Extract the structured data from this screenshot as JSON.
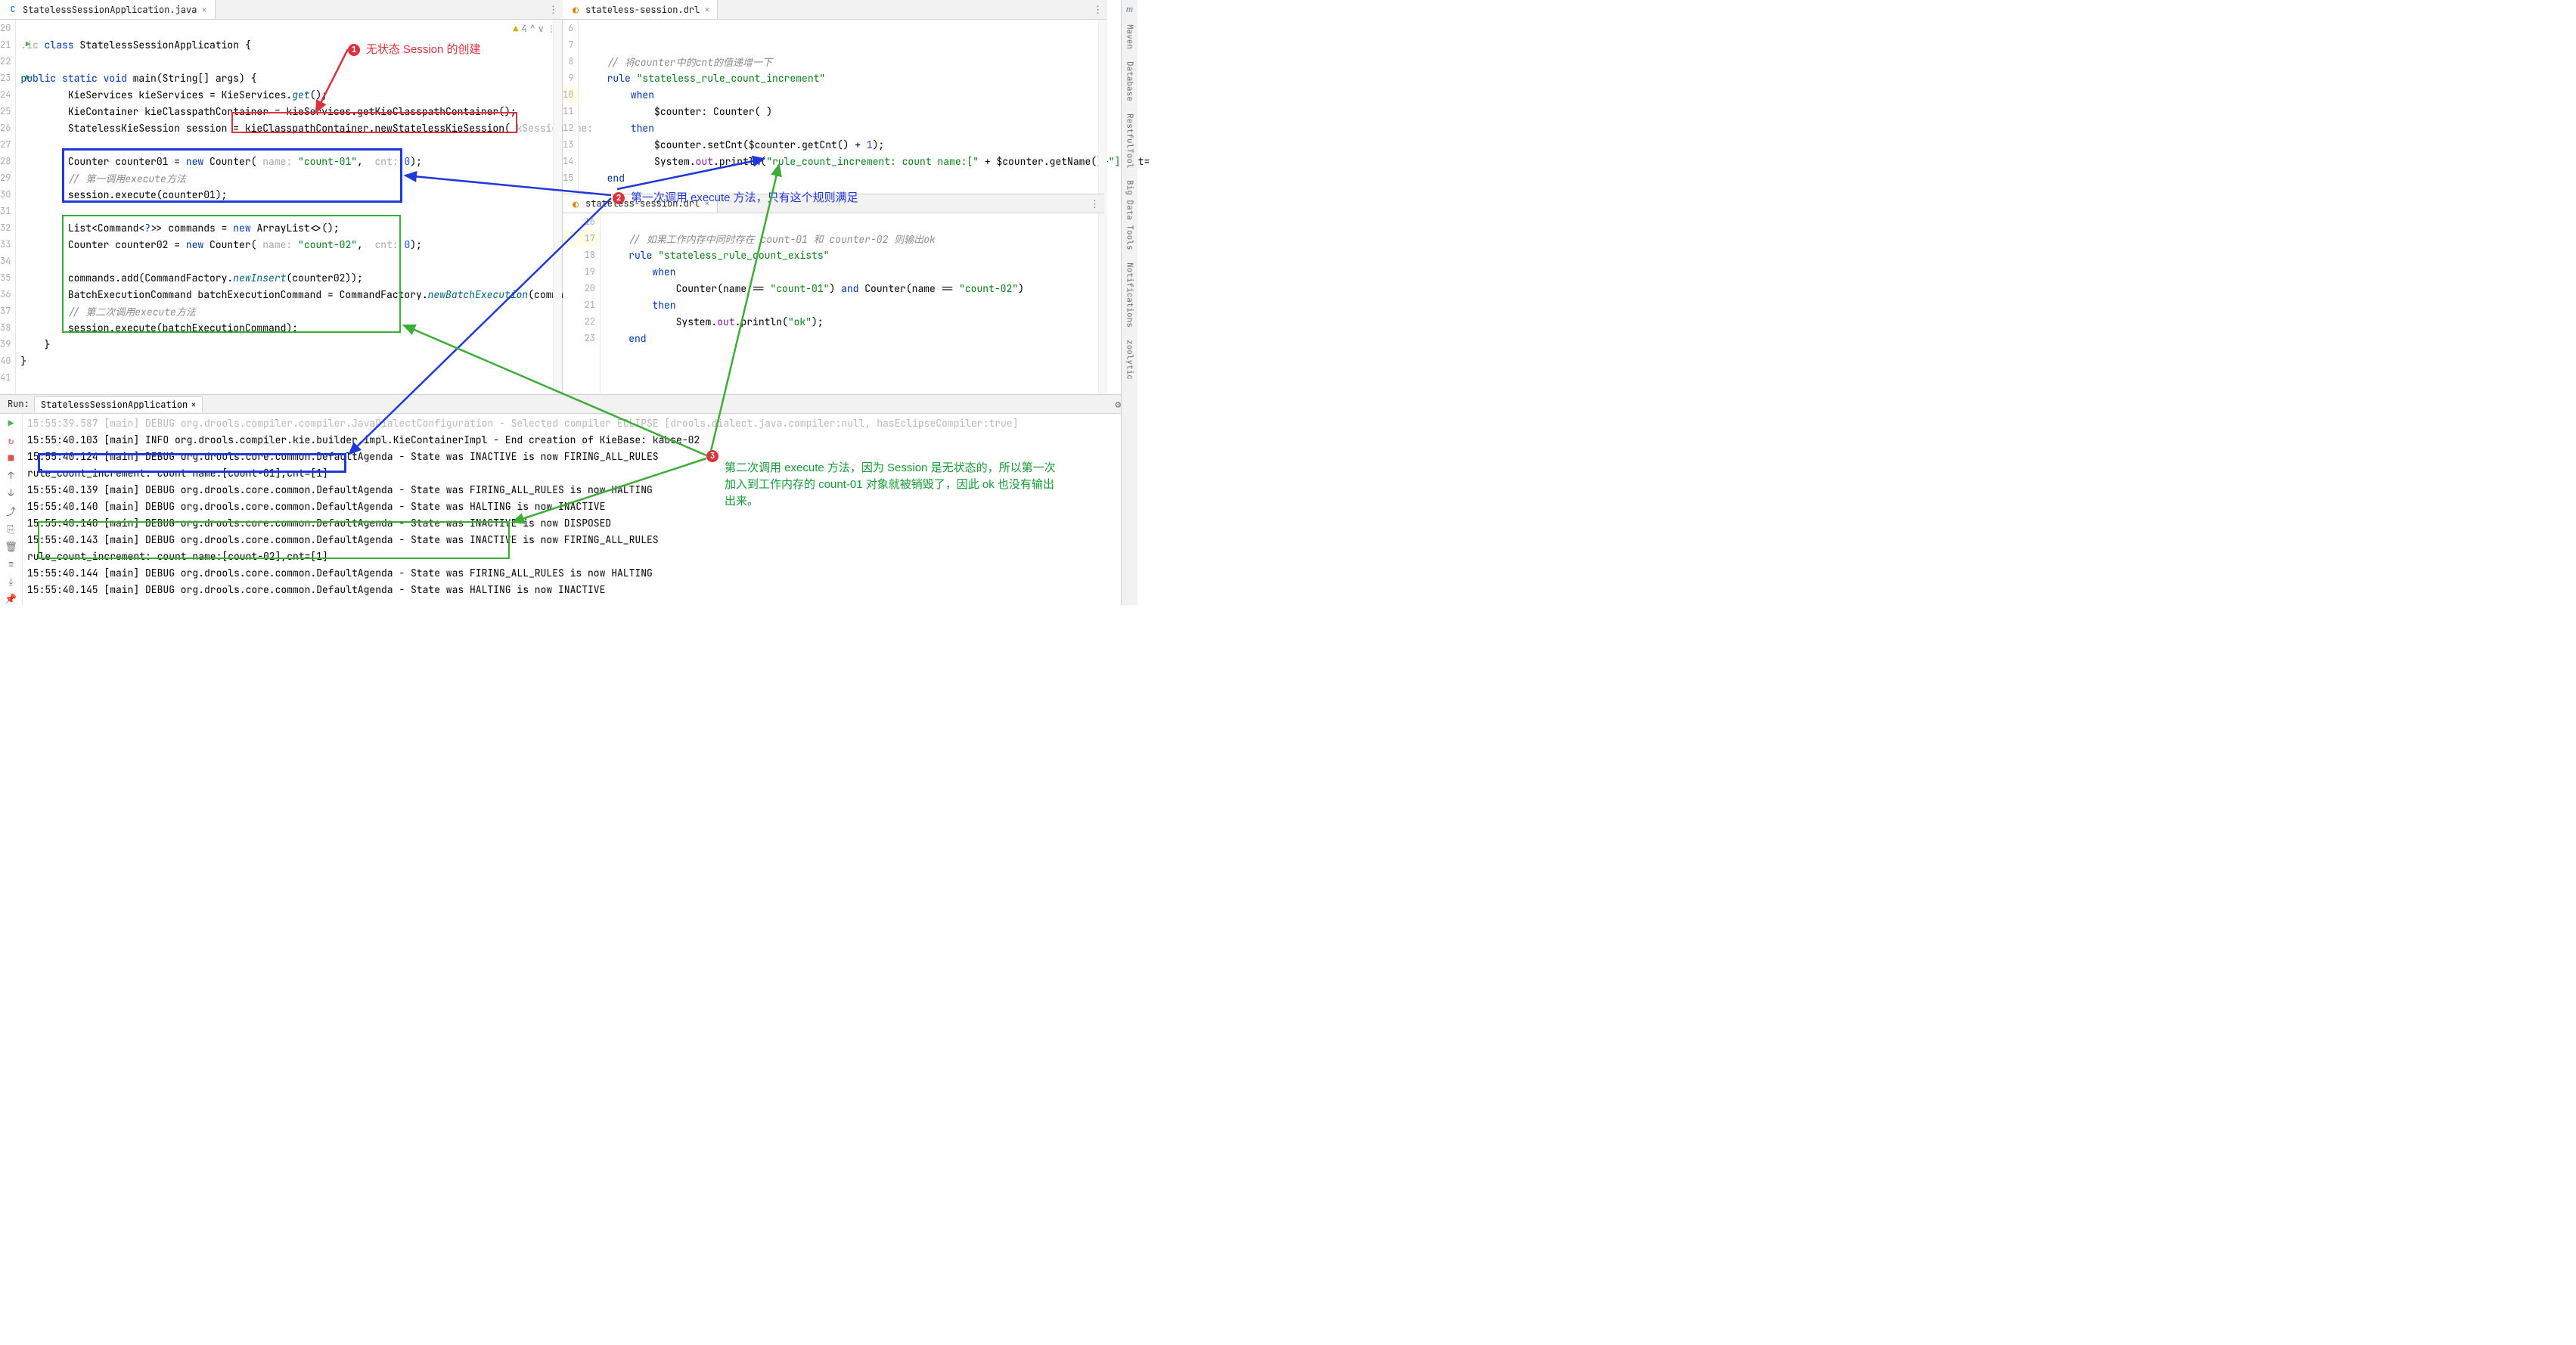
{
  "tabs": {
    "left": {
      "icon": "java",
      "name": "StatelessSessionApplication.java"
    },
    "right_top": {
      "icon": "drl",
      "name": "stateless-session.drl"
    },
    "right_bottom": {
      "icon": "drl",
      "name": "stateless-session.drl"
    }
  },
  "inspection": {
    "warn_count": "4"
  },
  "left_gutter": [
    "20",
    "21",
    "22",
    "23",
    "24",
    "25",
    "26",
    "27",
    "28",
    "29",
    "30",
    "31",
    "32",
    "33",
    "34",
    "35",
    "36",
    "37",
    "38",
    "39",
    "40",
    "41"
  ],
  "left_run_rows": [
    "21",
    "23"
  ],
  "left_lines": {
    "20": "",
    "21": {
      "pre": ".ic ",
      "kw": "class",
      "rest": " StatelessSessionApplication {"
    },
    "22": "",
    "23": {
      "kw1": "public static ",
      "kw2": "void",
      "name": " main",
      "rest": "(String[] args) {"
    },
    "24": {
      "indent": "        ",
      "t": "KieServices kieServices = KieServices.",
      "mth": "get",
      "t2": "();"
    },
    "25": {
      "indent": "        ",
      "t": "KieContainer kieClasspathContainer = kieServices.getKieClasspathContainer();"
    },
    "26": {
      "indent": "        ",
      "t": "StatelessKieSession session = kieClasspathContainer.newStatelessKieSession(",
      "hint": " kSessionName:"
    },
    "27": "",
    "28": {
      "indent": "        ",
      "t": "Counter counter01 = ",
      "kw": "new",
      "t2": " Counter(",
      "h1": " name: ",
      "s1": "\"count-01\"",
      "c": ",",
      "h2": "  cnt: ",
      "n": "0",
      "t3": ");"
    },
    "29": {
      "indent": "        ",
      "cmt": "// 第一调用execute方法"
    },
    "30": {
      "indent": "        ",
      "t": "session.execute(counter01);"
    },
    "31": "",
    "32": {
      "indent": "        ",
      "t": "List<Command<",
      "kw": "?",
      "t2": ">> commands = ",
      "kw2": "new",
      "t3": " ArrayList<>();"
    },
    "33": {
      "indent": "        ",
      "t": "Counter counter02 = ",
      "kw": "new",
      "t2": " Counter(",
      "h1": " name: ",
      "s1": "\"count-02\"",
      "c": ",",
      "h2": "  cnt: ",
      "n": "0",
      "t3": ");"
    },
    "34": "",
    "35": {
      "indent": "        ",
      "t": "commands.add(CommandFactory.",
      "mth": "newInsert",
      "t2": "(counter02));"
    },
    "36": {
      "indent": "        ",
      "t": "BatchExecutionCommand batchExecutionCommand = CommandFactory.",
      "mth": "newBatchExecution",
      "t2": "(commands)"
    },
    "37": {
      "indent": "        ",
      "cmt": "// 第二次调用execute方法"
    },
    "38": {
      "indent": "        ",
      "t": "session.execute(batchExecutionCommand);"
    },
    "39": "    }",
    "40": "}",
    "41": ""
  },
  "right_top_gutter": [
    "6",
    "7",
    "8",
    "9",
    "10",
    "11",
    "12",
    "13",
    "14",
    "15"
  ],
  "right_top_lines": {
    "6": "",
    "7": "",
    "8": {
      "cmt": "// 将counter中的cnt的值递增一下"
    },
    "9": {
      "kw": "rule ",
      "s": "\"stateless_rule_count_increment\""
    },
    "10": {
      "kw": "when"
    },
    "11": {
      "t": "$counter: Counter( )"
    },
    "12": {
      "kw": "then"
    },
    "13": {
      "t": "$counter.setCnt($counter.getCnt() + ",
      "n": "1",
      "t2": ");"
    },
    "14": {
      "t": "System.",
      "f": "out",
      "t2": ".println(",
      "s": "\"rule_count_increment: count name:[\"",
      "t3": " + $counter.getName()+",
      "s2": "\"]",
      "t4": ",cnt="
    },
    "15": {
      "kw": "end"
    }
  },
  "right_bot_gutter": [
    "16",
    "17",
    "18",
    "19",
    "20",
    "21",
    "22",
    "23"
  ],
  "right_bot_lines": {
    "16": "",
    "17": {
      "cmt": "// 如果工作内存中同时存在 count-01 和 counter-02 则输出ok"
    },
    "18": {
      "kw": "rule ",
      "s": "\"stateless_rule_count_exists\""
    },
    "19": {
      "kw": "when"
    },
    "20": {
      "t": "Counter(name == ",
      "s": "\"count-01\"",
      "t2": ") ",
      "kw": "and",
      "t3": " Counter(name == ",
      "s2": "\"count-02\"",
      "t4": ")"
    },
    "21": {
      "kw": "then"
    },
    "22": {
      "t": "System.",
      "f": "out",
      "t2": ".println(",
      "s": "\"ok\"",
      "t3": ");"
    },
    "23": {
      "kw": "end"
    }
  },
  "annotations": {
    "a1": "无状态 Session 的创建",
    "a2": "第一次调用 execute 方法，只有这个规则满足",
    "a3_line1": "第二次调用 execute 方法，因为 Session 是无状态的，所以第一次",
    "a3_line2": "加入到工作内存的 count-01 对象就被销毁了，因此 ok 也没有输出",
    "a3_line3": "出来。"
  },
  "run": {
    "header": "Run:",
    "tab": "StatelessSessionApplication",
    "lines": [
      "15:55:39.587 [main] DEBUG org.drools.compiler.compiler.JavaDialectConfiguration - Selected compiler ECLIPSE [drools.dialect.java.compiler:null, hasEclipseCompiler:true]",
      "15:55:40.103 [main] INFO org.drools.compiler.kie.builder.impl.KieContainerImpl - End creation of KieBase: kabse-02",
      "15:55:40.124 [main] DEBUG org.drools.core.common.DefaultAgenda - State was INACTIVE is now FIRING_ALL_RULES",
      "rule_count_increment: count name:[count-01],cnt=[1]",
      "15:55:40.139 [main] DEBUG org.drools.core.common.DefaultAgenda - State was FIRING_ALL_RULES is now HALTING",
      "15:55:40.140 [main] DEBUG org.drools.core.common.DefaultAgenda - State was HALTING is now INACTIVE",
      "15:55:40.140 [main] DEBUG org.drools.core.common.DefaultAgenda - State was INACTIVE is now DISPOSED",
      "15:55:40.143 [main] DEBUG org.drools.core.common.DefaultAgenda - State was INACTIVE is now FIRING_ALL_RULES",
      "rule_count_increment: count name:[count-02],cnt=[1]",
      "15:55:40.144 [main] DEBUG org.drools.core.common.DefaultAgenda - State was FIRING_ALL_RULES is now HALTING",
      "15:55:40.145 [main] DEBUG org.drools.core.common.DefaultAgenda - State was HALTING is now INACTIVE"
    ]
  },
  "right_bar_items": [
    "Maven",
    "Database",
    "RestfulTool",
    "Big Data Tools",
    "Notifications",
    "zoolytic"
  ],
  "toolbar_icons": {
    "play": "▶",
    "rerun": "↻",
    "stop": "■",
    "up": "↑",
    "down": "↓",
    "export": "⤓",
    "printer": "⎙",
    "trash": "🗑",
    "wrap": "≡",
    "scroll": "⤓",
    "pin": "📌"
  }
}
